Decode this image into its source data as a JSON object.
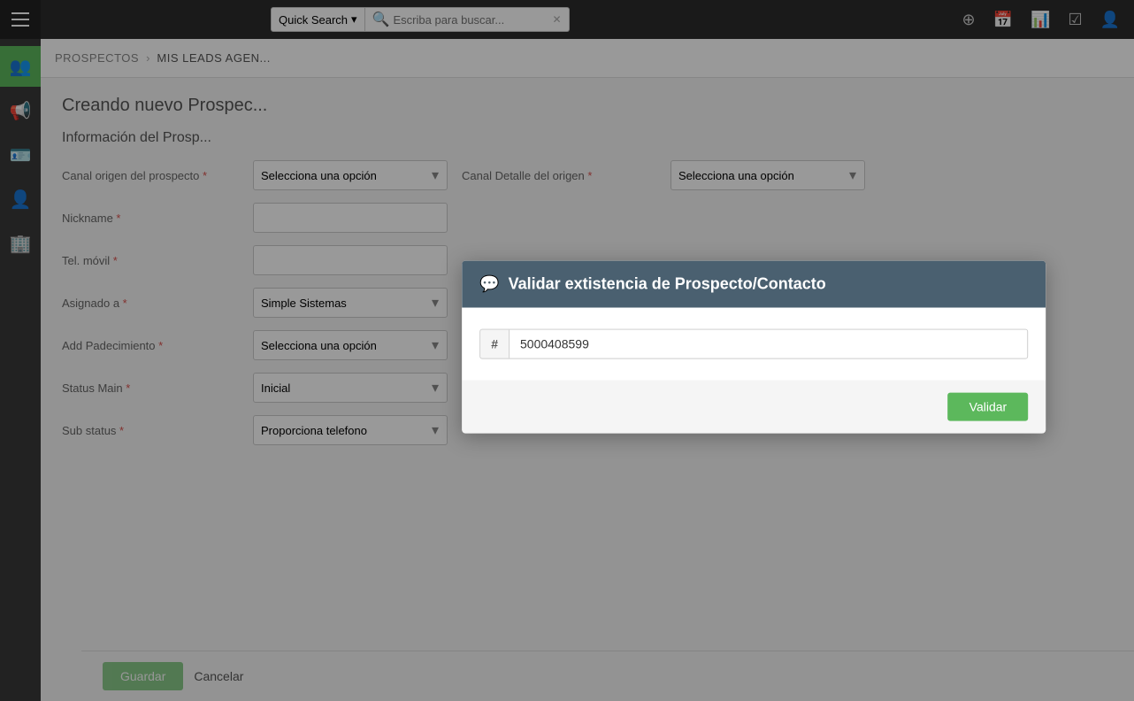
{
  "topbar": {
    "quick_search_label": "Quick Search",
    "search_placeholder": "Escriba para buscar...",
    "dropdown_arrow": "▾"
  },
  "sidebar": {
    "items": [
      {
        "id": "menu",
        "icon": "☰",
        "label": "menu-icon"
      },
      {
        "id": "users-group",
        "icon": "👥",
        "label": "users-group-icon",
        "active": true
      },
      {
        "id": "megaphone",
        "icon": "📢",
        "label": "megaphone-icon"
      },
      {
        "id": "id-card",
        "icon": "🪪",
        "label": "id-card-icon"
      },
      {
        "id": "person",
        "icon": "👤",
        "label": "person-icon"
      },
      {
        "id": "building",
        "icon": "🏢",
        "label": "building-icon"
      }
    ]
  },
  "breadcrumb": {
    "root": "PROSPECTOS",
    "separator": "›",
    "current": "Mis Leads Agen..."
  },
  "form": {
    "creating_title": "Creando nuevo Prospec...",
    "section_title": "Información del Prosp...",
    "fields": [
      {
        "label": "Canal origen del prospecto",
        "required": true,
        "type": "select",
        "value": "Selecciona una opción",
        "col2_label": "Canal Detalle del origen",
        "col2_required": true,
        "col2_value": "Selecciona una opción"
      },
      {
        "label": "Nickname",
        "required": true,
        "type": "text",
        "value": ""
      },
      {
        "label": "Tel. móvil",
        "required": true,
        "type": "text",
        "value": ""
      },
      {
        "label": "Asignado a",
        "required": true,
        "type": "select",
        "value": "Simple Sistemas"
      },
      {
        "label": "Add Padecimiento",
        "required": true,
        "type": "select",
        "value": "Selecciona una opción"
      },
      {
        "label": "Status Main",
        "required": true,
        "type": "select",
        "value": "Inicial"
      },
      {
        "label": "Sub status",
        "required": true,
        "type": "select",
        "value": "Proporciona telefono"
      }
    ],
    "save_label": "Guardar",
    "cancel_label": "Cancelar"
  },
  "modal": {
    "title": "Validar extistencia de Prospecto/Contacto",
    "hash_symbol": "#",
    "input_value": "5000408599",
    "validate_button": "Validar",
    "icon": "💬"
  }
}
